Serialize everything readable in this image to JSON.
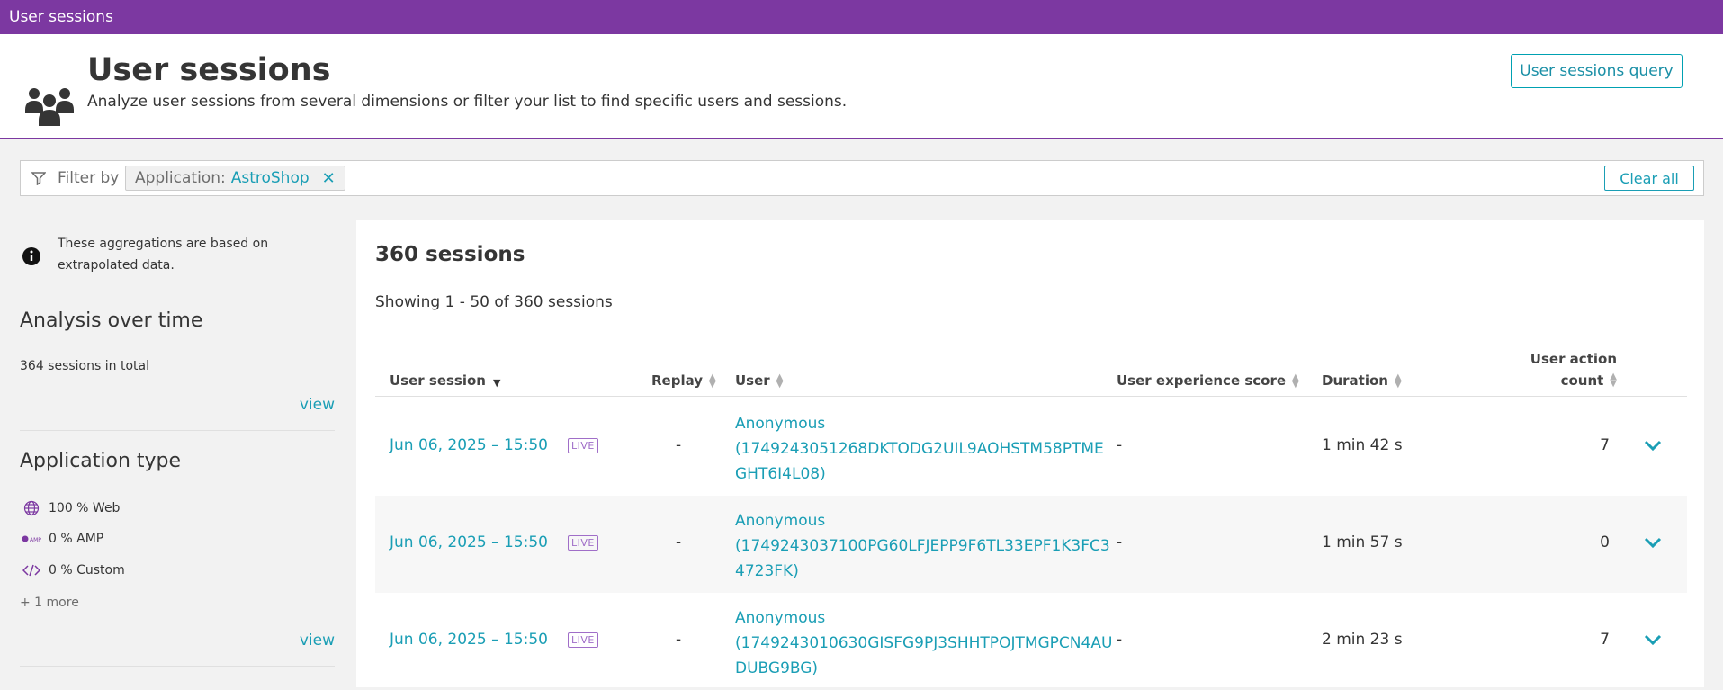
{
  "topbar": {
    "title": "User sessions"
  },
  "header": {
    "title": "User sessions",
    "subtitle": "Analyze user sessions from several dimensions or filter your list to find specific users and sessions.",
    "query_button": "User sessions query",
    "icon": "users-group-icon"
  },
  "filter": {
    "label": "Filter by",
    "chip_key": "Application:",
    "chip_value": "AstroShop",
    "clear_all": "Clear all"
  },
  "sidebar": {
    "info": "These aggregations are based on extrapolated data.",
    "analysis_title": "Analysis over time",
    "sessions_total": "364 sessions in total",
    "view1": "view",
    "apptype_title": "Application type",
    "apptypes": [
      {
        "label": "100 % Web",
        "icon": "globe-icon"
      },
      {
        "label": "0 % AMP",
        "icon": "amp-icon"
      },
      {
        "label": "0 % Custom",
        "icon": "code-icon"
      }
    ],
    "more": "+ 1 more",
    "view2": "view"
  },
  "main": {
    "count_title": "360 sessions",
    "showing": "Showing 1 - 50 of 360 sessions",
    "columns": {
      "session": "User session",
      "replay": "Replay",
      "user": "User",
      "ux": "User experience score",
      "duration": "Duration",
      "actions_1": "User action",
      "actions_2": "count"
    },
    "rows": [
      {
        "date": "Jun 06, 2025  –  15:50",
        "live": "LIVE",
        "replay": "-",
        "user_1": "Anonymous",
        "user_2": "(1749243051268DKTODG2UIL9AOHSTM58PTME",
        "user_3": "GHT6I4L08)",
        "ux": "-",
        "duration": "1 min 42 s",
        "actions": "7"
      },
      {
        "date": "Jun 06, 2025  –  15:50",
        "live": "LIVE",
        "replay": "-",
        "user_1": "Anonymous",
        "user_2": "(1749243037100PG60LFJEPP9F6TL33EPF1K3FC3",
        "user_3": "4723FK)",
        "ux": "-",
        "duration": "1 min 57 s",
        "actions": "0"
      },
      {
        "date": "Jun 06, 2025  –  15:50",
        "live": "LIVE",
        "replay": "-",
        "user_1": "Anonymous",
        "user_2": "(1749243010630GISFG9PJ3SHHTPOJTMGPCN4AU",
        "user_3": "DUBG9BG)",
        "ux": "-",
        "duration": "2 min 23 s",
        "actions": "7"
      }
    ]
  },
  "colors": {
    "brand": "#7c38a1",
    "link": "#1a9eb5",
    "live": "#a06ec8"
  }
}
